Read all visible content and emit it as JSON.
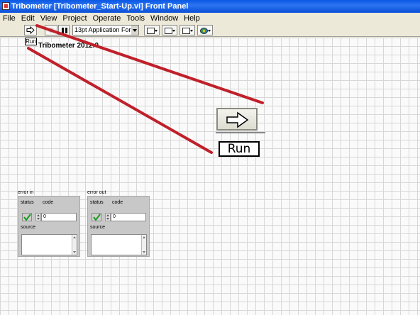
{
  "window": {
    "title": "Tribometer [Tribometer_Start-Up.vi] Front Panel"
  },
  "menu": {
    "items": [
      "File",
      "Edit",
      "View",
      "Project",
      "Operate",
      "Tools",
      "Window",
      "Help"
    ]
  },
  "toolbar": {
    "font_select": "13pt Application Font"
  },
  "panel": {
    "run_control_label": "Run",
    "vi_title": "Tribometer 2012.0",
    "zoom_run_label": "Run"
  },
  "error_in": {
    "label": "error in",
    "status_label": "status",
    "code_label": "code",
    "code_value": "0",
    "source_label": "source"
  },
  "error_out": {
    "label": "error out",
    "status_label": "status",
    "code_label": "code",
    "code_value": "0",
    "source_label": "source"
  },
  "colors": {
    "annotation": "#c0202a",
    "titlebar": "#0a57e4",
    "status_ok": "#1a9a1a"
  },
  "icons": [
    "labview-vi-icon",
    "run-arrow-icon",
    "abort-icon",
    "pause-icon",
    "align-icon",
    "distribute-icon",
    "resize-icon",
    "reorder-icon",
    "check-icon"
  ]
}
